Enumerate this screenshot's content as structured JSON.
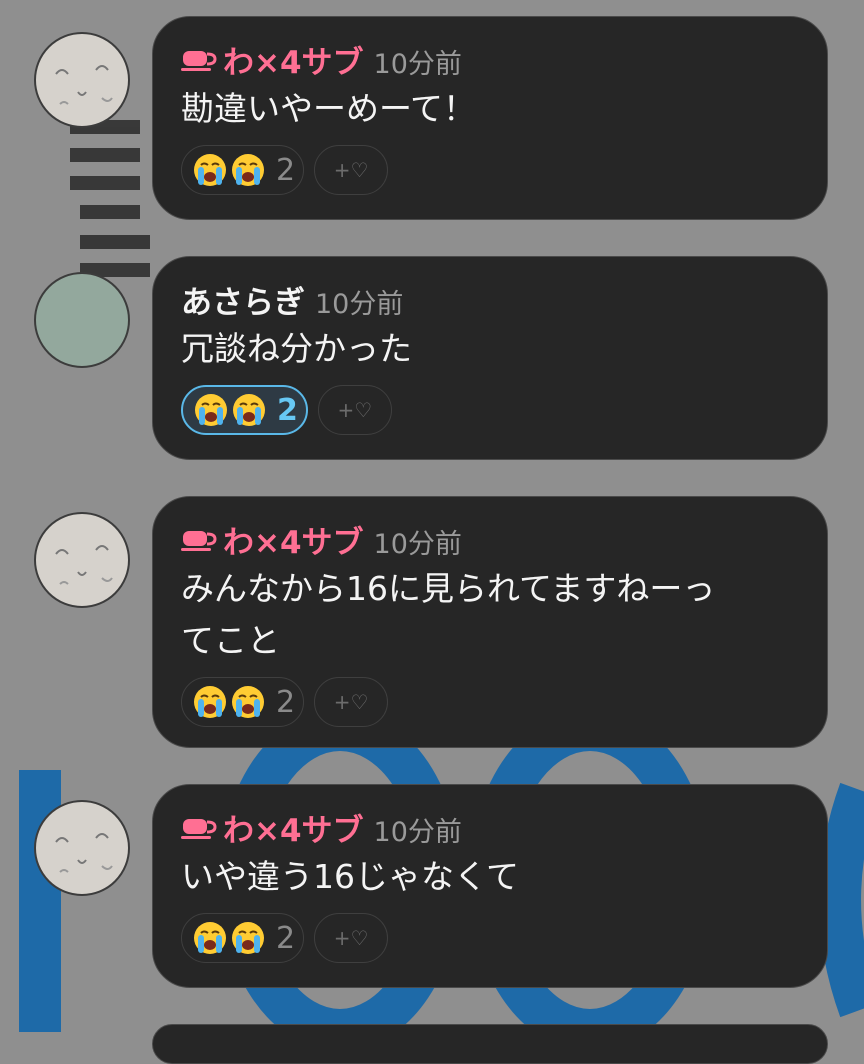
{
  "messages": [
    {
      "author": "わ×4サブ",
      "author_style": "pink",
      "has_cup_icon": true,
      "avatar": "doodle",
      "time": "10分前",
      "text_lines": [
        "勘違いやーめーて！"
      ],
      "reaction": {
        "emoji": "loudly-crying-face",
        "count": "2",
        "active": false
      },
      "add_reaction_label": "+♡"
    },
    {
      "author": "あさらぎ",
      "author_style": "white",
      "has_cup_icon": false,
      "avatar": "plain",
      "time": "10分前",
      "text_lines": [
        "冗談ね分かった"
      ],
      "reaction": {
        "emoji": "loudly-crying-face",
        "count": "2",
        "active": true
      },
      "add_reaction_label": "+♡"
    },
    {
      "author": "わ×4サブ",
      "author_style": "pink",
      "has_cup_icon": true,
      "avatar": "doodle",
      "time": "10分前",
      "text_lines": [
        "みんなから16に見られてますねーっ",
        "てこと"
      ],
      "reaction": {
        "emoji": "loudly-crying-face",
        "count": "2",
        "active": false
      },
      "add_reaction_label": "+♡"
    },
    {
      "author": "わ×4サブ",
      "author_style": "pink",
      "has_cup_icon": true,
      "avatar": "doodle",
      "time": "10分前",
      "text_lines": [
        "いや違う16じゃなくて"
      ],
      "reaction": {
        "emoji": "loudly-crying-face",
        "count": "2",
        "active": false
      },
      "add_reaction_label": "+♡"
    }
  ],
  "colors": {
    "background": "#8f8f8f",
    "bubble": "#262626",
    "author_pink": "#ff6f93",
    "reaction_active_border": "#5ab8e8"
  }
}
